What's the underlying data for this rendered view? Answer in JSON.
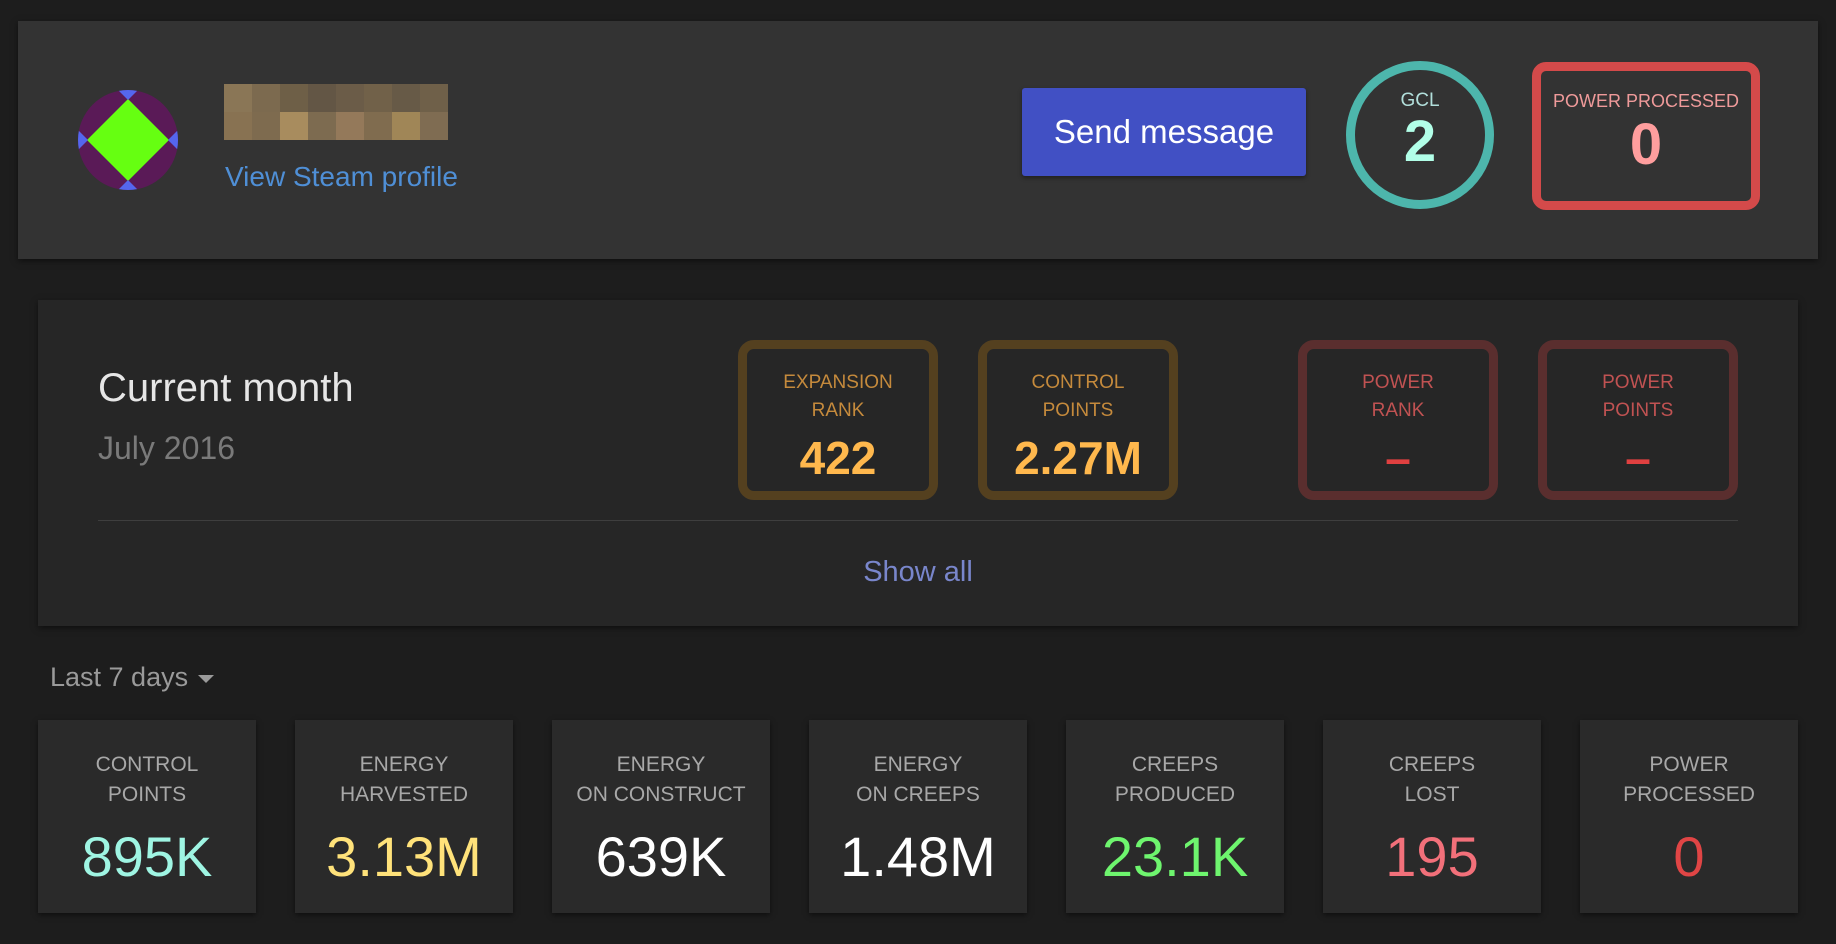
{
  "header": {
    "steam_link": "View Steam profile",
    "send_message": "Send message",
    "gcl": {
      "label": "GCL",
      "value": "2"
    },
    "power_processed": {
      "label": "POWER PROCESSED",
      "value": "0"
    },
    "colors": {
      "gcl_ring": "#4db6ac",
      "power_border": "#d44a4a",
      "button": "#4150c4",
      "link": "#4f8fd6"
    }
  },
  "month": {
    "title": "Current month",
    "subtitle": "July 2016",
    "ranks": [
      {
        "line1": "EXPANSION",
        "line2": "RANK",
        "value": "422"
      },
      {
        "line1": "CONTROL",
        "line2": "POINTS",
        "value": "2.27M"
      },
      {
        "line1": "POWER",
        "line2": "RANK",
        "value": "–"
      },
      {
        "line1": "POWER",
        "line2": "POINTS",
        "value": "–"
      }
    ],
    "show_all": "Show all"
  },
  "period": {
    "selected": "Last 7 days"
  },
  "stats": [
    {
      "line1": "CONTROL",
      "line2": "POINTS",
      "value": "895K",
      "color": "#9ff5e3"
    },
    {
      "line1": "ENERGY",
      "line2": "HARVESTED",
      "value": "3.13M",
      "color": "#ffe27a"
    },
    {
      "line1": "ENERGY",
      "line2": "ON CONSTRUCT",
      "value": "639K",
      "color": "#ffffff"
    },
    {
      "line1": "ENERGY",
      "line2": "ON CREEPS",
      "value": "1.48M",
      "color": "#ffffff"
    },
    {
      "line1": "CREEPS",
      "line2": "PRODUCED",
      "value": "23.1K",
      "color": "#6ef56e"
    },
    {
      "line1": "CREEPS",
      "line2": "LOST",
      "value": "195",
      "color": "#f2707a"
    },
    {
      "line1": "POWER",
      "line2": "PROCESSED",
      "value": "0",
      "color": "#e04545"
    }
  ]
}
